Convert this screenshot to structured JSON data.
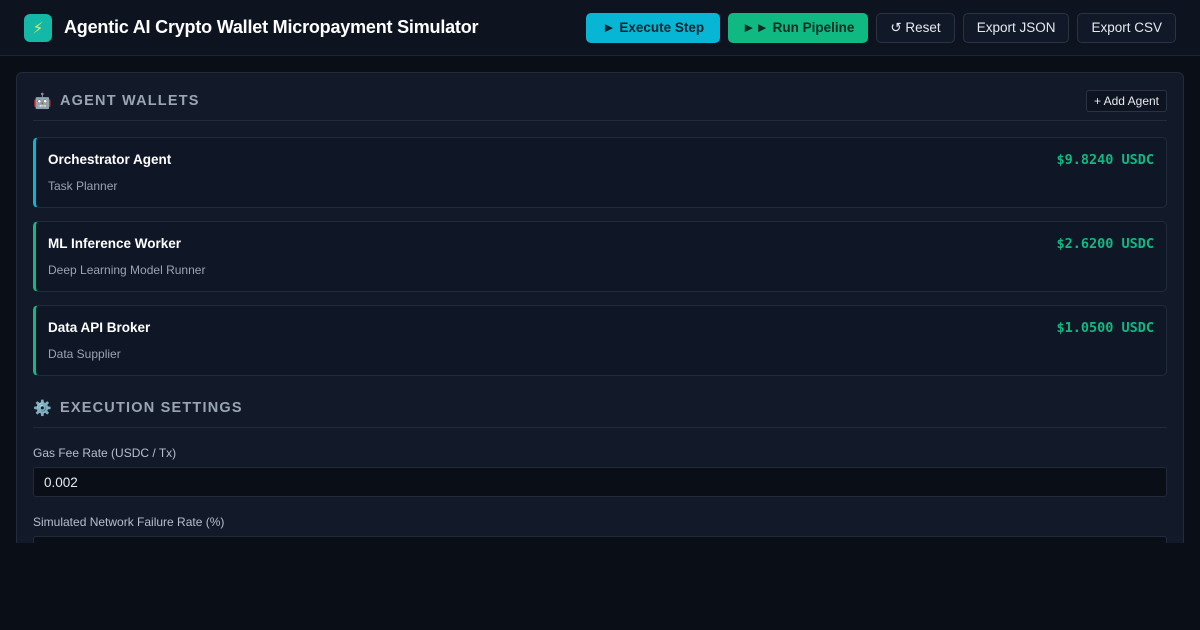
{
  "header": {
    "logo_icon": "bolt-icon",
    "logo_glyph": "⚡",
    "title": "Agentic AI Crypto Wallet Micropayment Simulator",
    "buttons": {
      "execute_step": "► Execute Step",
      "run_pipeline": "►► Run Pipeline",
      "reset": "↺ Reset",
      "export_json": "Export JSON",
      "export_csv": "Export CSV"
    }
  },
  "wallets_section": {
    "icon": "robot-icon",
    "icon_glyph": "🤖",
    "title": "Agent Wallets",
    "add_agent_label": "+ Add Agent",
    "agents": [
      {
        "name": "Orchestrator Agent",
        "role": "Task Planner",
        "balance": "$9.8240 USDC",
        "accent": "#06b6d4"
      },
      {
        "name": "ML Inference Worker",
        "role": "Deep Learning Model Runner",
        "balance": "$2.6200 USDC",
        "accent": "#10b981"
      },
      {
        "name": "Data API Broker",
        "role": "Data Supplier",
        "balance": "$1.0500 USDC",
        "accent": "#10b981"
      }
    ]
  },
  "settings_section": {
    "icon": "gear-icon",
    "icon_glyph": "⚙️",
    "title": "Execution Settings",
    "gas_fee_label": "Gas Fee Rate (USDC / Tx)",
    "gas_fee_value": "0.002",
    "failure_rate_label": "Simulated Network Failure Rate (%)",
    "failure_rate_value": ""
  },
  "colors": {
    "primary": "#06b6d4",
    "success": "#10b981",
    "background": "#0a0e17",
    "panel": "#121a29"
  }
}
